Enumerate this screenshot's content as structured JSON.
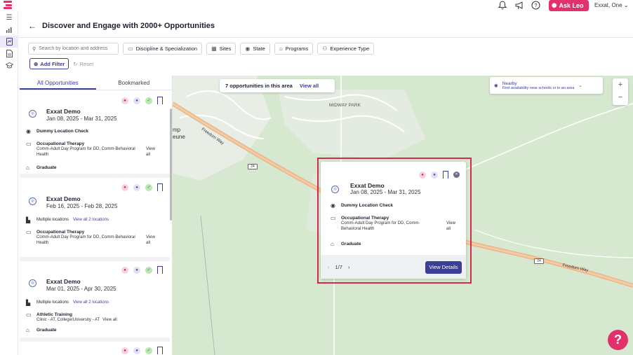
{
  "topbar": {
    "ask_label": "Ask Leo",
    "user_name": "Exxat, One",
    "icons": [
      "bell-icon",
      "megaphone-icon",
      "help-circle-icon"
    ]
  },
  "header": {
    "title": "Discover and Engage with 2000+ Opportunities"
  },
  "filters": {
    "search_placeholder": "Search by location and address",
    "chips": [
      "Discipline & Specialization",
      "Sites",
      "State",
      "Programs",
      "Experience Type"
    ],
    "add_filter": "Add Filter",
    "reset": "Reset"
  },
  "list": {
    "tabs": [
      "All Opportunities",
      "Bookmarked"
    ],
    "cards": [
      {
        "title": "Exxat Demo",
        "dates": "Jan 08, 2025 - Mar 31, 2025",
        "location": "Dummy Location Check",
        "discipline": "Occupational Therapy",
        "programs": "Comm-Adult Day Program for DD, Comm-Behavioral Health",
        "view_all": "View all",
        "level": "Graduate"
      },
      {
        "title": "Exxat Demo",
        "dates": "Feb 16, 2025 - Feb 28, 2025",
        "location": "Multiple locations",
        "location_link": "View all 2 locations",
        "discipline": "Occupational Therapy",
        "programs": "Comm-Adult Day Program for DD, Comm-Behavioral Health",
        "view_all": "View all"
      },
      {
        "title": "Exxat Demo",
        "dates": "Mar 01, 2025 - Apr 30, 2025",
        "location": "Multiple locations",
        "location_link": "View all 2 locations",
        "discipline": "Athletic Training",
        "programs": "Clinic - AT, College/University - AT",
        "view_all": "View all",
        "level": "Graduate"
      }
    ]
  },
  "map": {
    "area_text": "7 opportunities in this area",
    "area_link": "View all",
    "nearby_title": "Nearby",
    "nearby_sub": "Find availability near schools or in an area",
    "labels": {
      "midway": "MIDWAY PARK",
      "camp1": "mp",
      "camp2": "eune",
      "road1": "Freedom Way",
      "road2": "Freedom Way",
      "shield1": "24",
      "shield2": "24"
    },
    "zoom_in": "+",
    "zoom_out": "−"
  },
  "popup": {
    "title": "Exxat Demo",
    "dates": "Jan 08, 2025 - Mar 31, 2025",
    "location": "Dummy Location Check",
    "discipline": "Occupational Therapy",
    "programs": "Comm-Adult Day Program for DD, Comm-Behavioral Health",
    "view_all": "View all",
    "level": "Graduate",
    "pager": "1/7",
    "button": "View Details"
  },
  "colors": {
    "brand": "#e2316a",
    "primary": "#3b3f95",
    "highlight": "#d12c4a"
  }
}
